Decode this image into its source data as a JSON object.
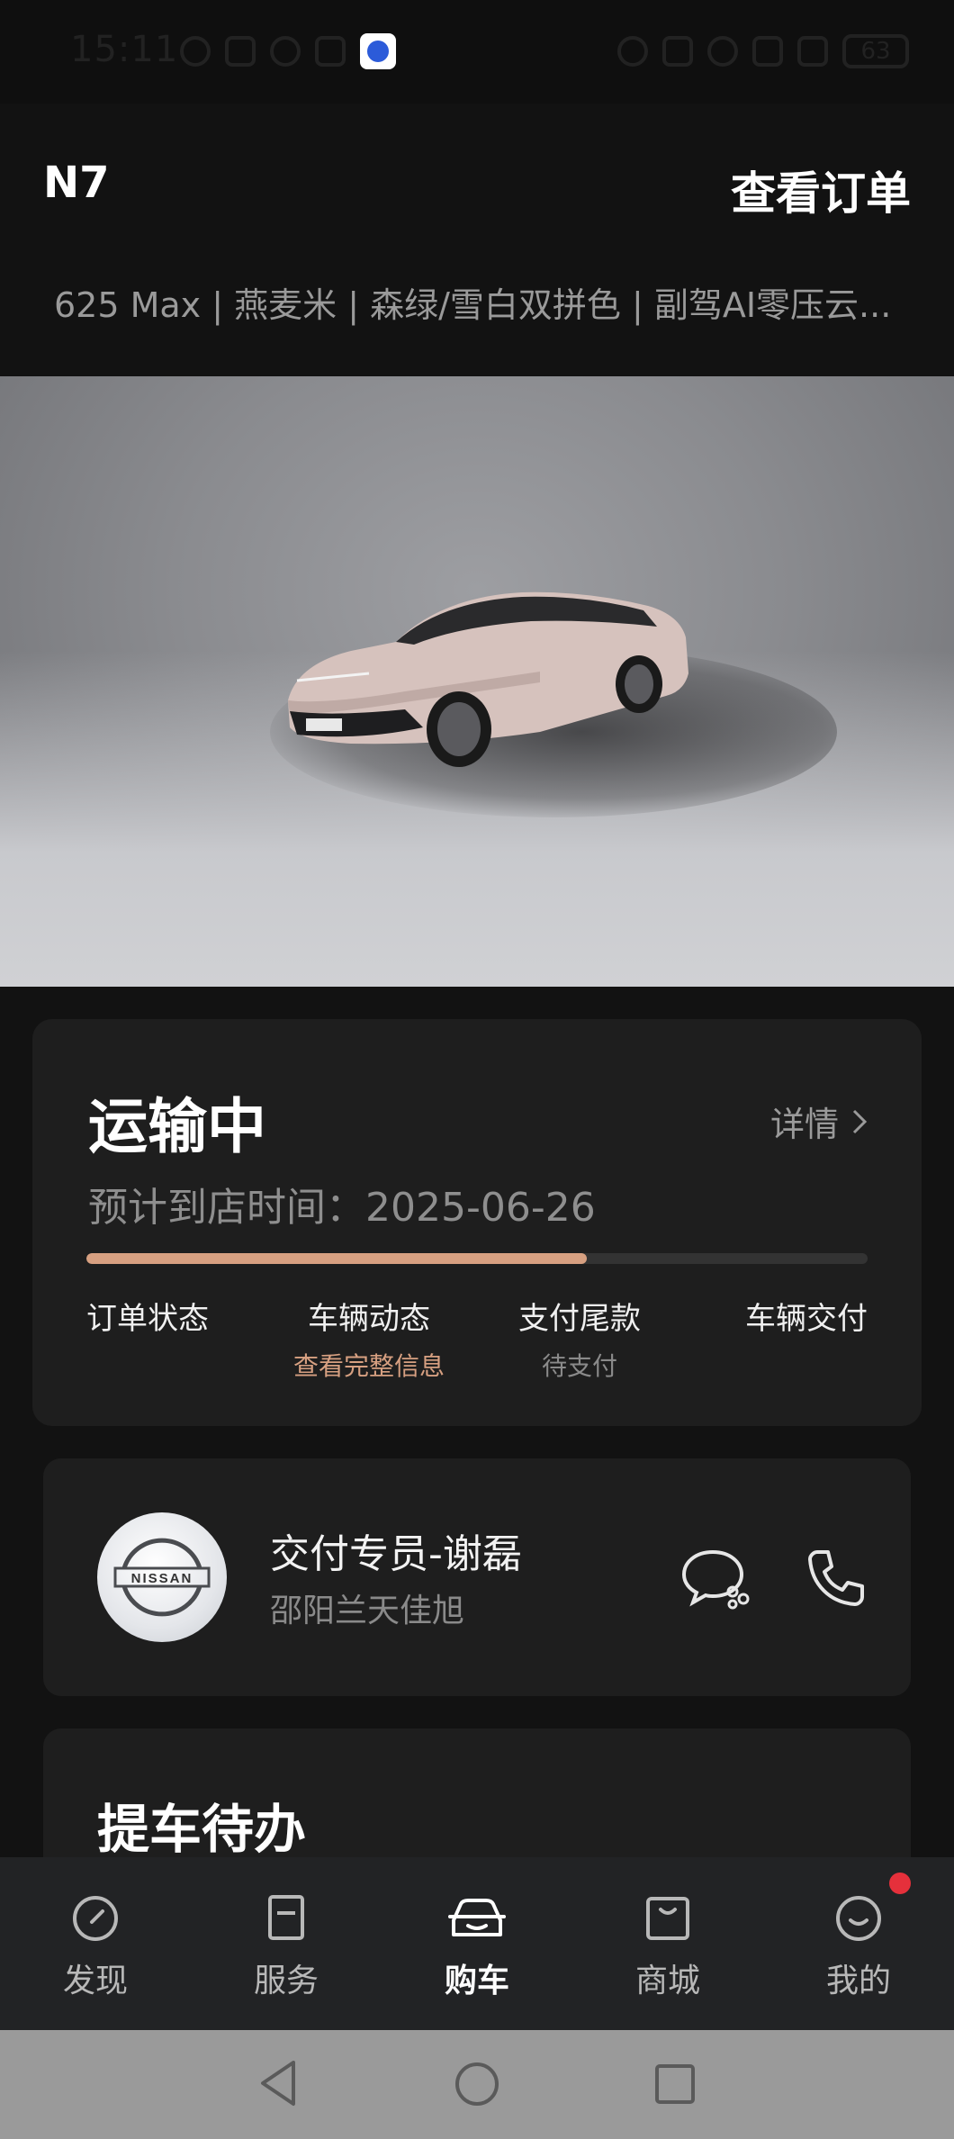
{
  "status_bar": {
    "time": "15:11",
    "battery": "63"
  },
  "header": {
    "title": "N7",
    "view_order_label": "查看订单",
    "config_summary": "625 Max | 燕麦米 | 森绿/雪白双拼色 | 副驾AI零压云..."
  },
  "status_card": {
    "title": "运输中",
    "detail_label": "详情",
    "eta_label": "预计到店时间：",
    "eta_date": "2025-06-26",
    "progress": 0.64,
    "steps": [
      {
        "label": "订单状态",
        "sub": ""
      },
      {
        "label": "车辆动态",
        "sub": "查看完整信息"
      },
      {
        "label": "支付尾款",
        "sub": "待支付"
      },
      {
        "label": "车辆交付",
        "sub": ""
      }
    ]
  },
  "specialist": {
    "logo_text": "NISSAN",
    "name": "交付专员-谢磊",
    "store": "邵阳兰天佳旭"
  },
  "todo": {
    "title": "提车待办"
  },
  "bottom_nav": {
    "items": [
      {
        "label": "发现"
      },
      {
        "label": "服务"
      },
      {
        "label": "购车"
      },
      {
        "label": "商城"
      },
      {
        "label": "我的"
      }
    ]
  },
  "colors": {
    "accent": "#d7a081",
    "background": "#121212",
    "card": "#1e1e1e",
    "badge": "#e5303b"
  }
}
